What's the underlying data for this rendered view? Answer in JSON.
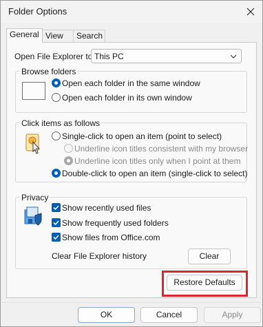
{
  "window": {
    "title": "Folder Options"
  },
  "tabs": [
    {
      "label": "General",
      "active": true
    },
    {
      "label": "View",
      "active": false
    },
    {
      "label": "Search",
      "active": false
    }
  ],
  "open_explorer": {
    "label": "Open File Explorer to:",
    "value": "This PC"
  },
  "browse_folders": {
    "title": "Browse folders",
    "options": [
      {
        "label": "Open each folder in the same window",
        "selected": true
      },
      {
        "label": "Open each folder in its own window",
        "selected": false
      }
    ]
  },
  "click_items": {
    "title": "Click items as follows",
    "single_click": {
      "label": "Single-click to open an item (point to select)",
      "selected": false
    },
    "underline_consistent": {
      "label": "Underline icon titles consistent with my browser",
      "selected": false,
      "disabled": true
    },
    "underline_point": {
      "label": "Underline icon titles only when I point at them",
      "selected": true,
      "disabled": true
    },
    "double_click": {
      "label": "Double-click to open an item (single-click to select)",
      "selected": true
    }
  },
  "privacy": {
    "title": "Privacy",
    "checks": [
      {
        "label": "Show recently used files",
        "checked": true
      },
      {
        "label": "Show frequently used folders",
        "checked": true
      },
      {
        "label": "Show files from Office.com",
        "checked": true
      }
    ],
    "clear_history_label": "Clear File Explorer history",
    "clear_button": "Clear"
  },
  "restore_defaults": "Restore Defaults",
  "footer": {
    "ok": "OK",
    "cancel": "Cancel",
    "apply": "Apply"
  },
  "colors": {
    "accent": "#005fb8",
    "highlight": "#d9262c"
  }
}
